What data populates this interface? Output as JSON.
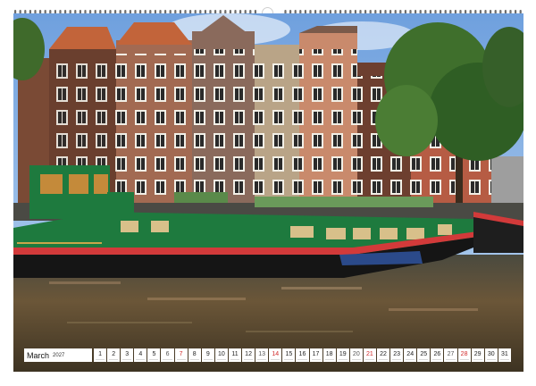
{
  "calendar": {
    "month": "March",
    "year": "2027",
    "days": [
      {
        "n": "1",
        "type": "weekday"
      },
      {
        "n": "2",
        "type": "weekday"
      },
      {
        "n": "3",
        "type": "weekday"
      },
      {
        "n": "4",
        "type": "weekday"
      },
      {
        "n": "5",
        "type": "weekday"
      },
      {
        "n": "6",
        "type": "sat"
      },
      {
        "n": "7",
        "type": "sun"
      },
      {
        "n": "8",
        "type": "weekday"
      },
      {
        "n": "9",
        "type": "weekday"
      },
      {
        "n": "10",
        "type": "weekday"
      },
      {
        "n": "11",
        "type": "weekday"
      },
      {
        "n": "12",
        "type": "weekday"
      },
      {
        "n": "13",
        "type": "sat"
      },
      {
        "n": "14",
        "type": "sun"
      },
      {
        "n": "15",
        "type": "weekday"
      },
      {
        "n": "16",
        "type": "weekday"
      },
      {
        "n": "17",
        "type": "weekday"
      },
      {
        "n": "18",
        "type": "weekday"
      },
      {
        "n": "19",
        "type": "weekday"
      },
      {
        "n": "20",
        "type": "sat"
      },
      {
        "n": "21",
        "type": "sun"
      },
      {
        "n": "22",
        "type": "weekday"
      },
      {
        "n": "23",
        "type": "weekday"
      },
      {
        "n": "24",
        "type": "weekday"
      },
      {
        "n": "25",
        "type": "weekday"
      },
      {
        "n": "26",
        "type": "weekday"
      },
      {
        "n": "27",
        "type": "sat"
      },
      {
        "n": "28",
        "type": "sun"
      },
      {
        "n": "29",
        "type": "weekday"
      },
      {
        "n": "30",
        "type": "weekday"
      },
      {
        "n": "31",
        "type": "weekday"
      }
    ]
  },
  "colors": {
    "sunday": "#d22b2b",
    "boat_hull": "#1e7a3e",
    "boat_stripe": "#d23a3a",
    "water": "#6b5638",
    "sky": "#8fb7e6"
  },
  "photo": {
    "icon": "canal-houseboat-photo"
  }
}
